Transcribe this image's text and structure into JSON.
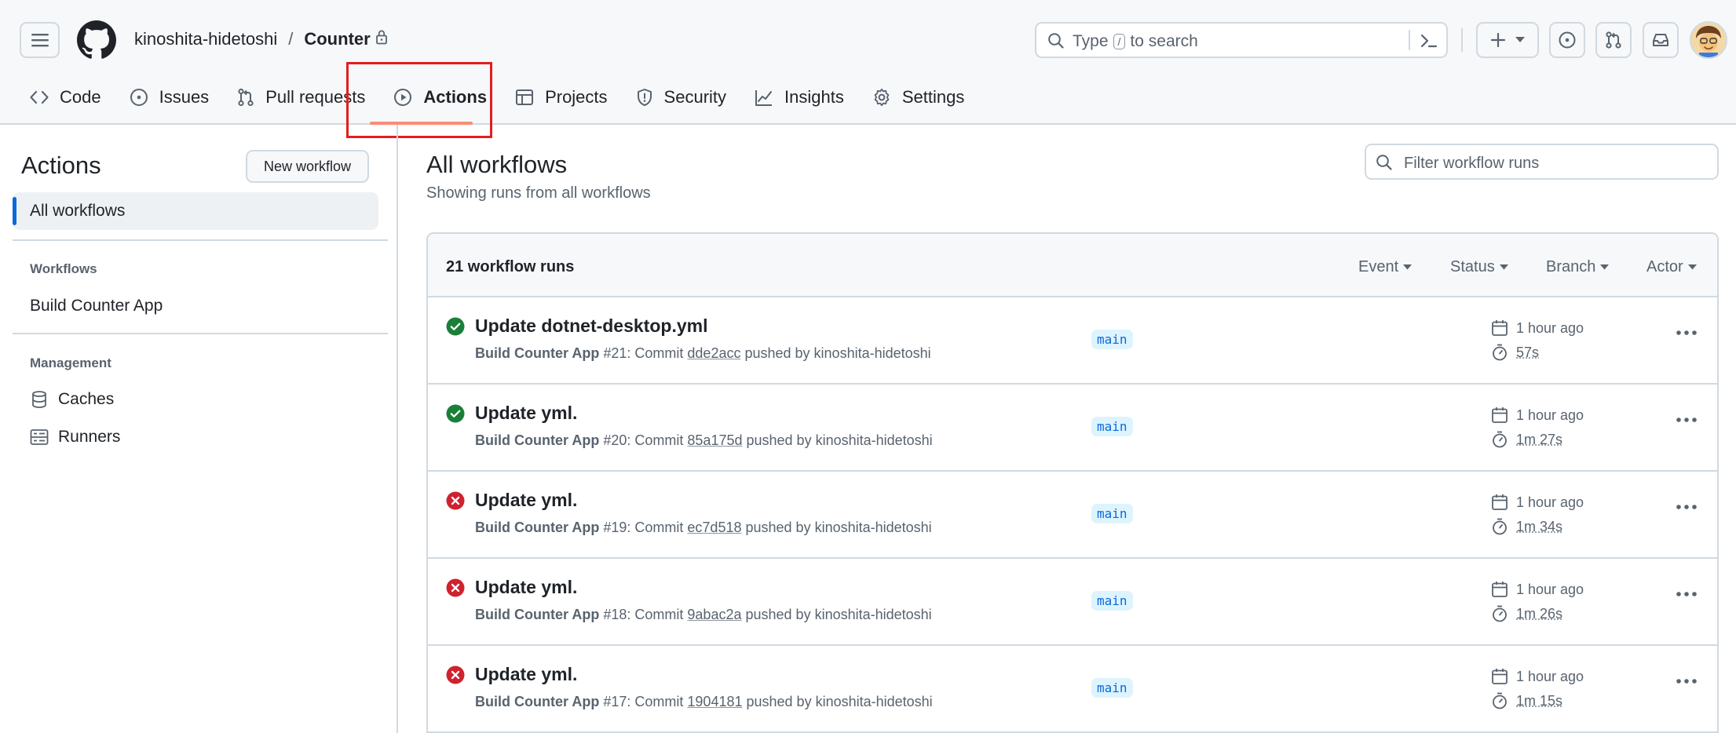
{
  "header": {
    "owner": "kinoshita-hidetoshi",
    "separator": "/",
    "repo": "Counter",
    "search_prefix": "Type",
    "search_key": "/",
    "search_suffix": "to search"
  },
  "nav": {
    "tabs": [
      {
        "label": "Code",
        "icon": "code-icon"
      },
      {
        "label": "Issues",
        "icon": "issue-icon"
      },
      {
        "label": "Pull requests",
        "icon": "pull-request-icon"
      },
      {
        "label": "Actions",
        "icon": "play-icon",
        "active": true
      },
      {
        "label": "Projects",
        "icon": "table-icon"
      },
      {
        "label": "Security",
        "icon": "shield-icon"
      },
      {
        "label": "Insights",
        "icon": "graph-icon"
      },
      {
        "label": "Settings",
        "icon": "gear-icon"
      }
    ]
  },
  "sidebar": {
    "title": "Actions",
    "new_workflow": "New workflow",
    "all_workflows": "All workflows",
    "workflows_heading": "Workflows",
    "workflows": [
      "Build Counter App"
    ],
    "management_heading": "Management",
    "management": [
      {
        "label": "Caches",
        "icon": "database-icon"
      },
      {
        "label": "Runners",
        "icon": "server-icon"
      }
    ]
  },
  "main": {
    "title": "All workflows",
    "subtitle": "Showing runs from all workflows",
    "filter_placeholder": "Filter workflow runs",
    "runs_count": "21 workflow runs",
    "filters": [
      "Event",
      "Status",
      "Branch",
      "Actor"
    ],
    "runs": [
      {
        "status": "success",
        "title": "Update dotnet-desktop.yml",
        "workflow": "Build Counter App",
        "number": "#21",
        "commit_label": "Commit",
        "sha": "dde2acc",
        "pushed_by": "pushed by kinoshita-hidetoshi",
        "branch": "main",
        "when": "1 hour ago",
        "duration": "57s"
      },
      {
        "status": "success",
        "title": "Update yml.",
        "workflow": "Build Counter App",
        "number": "#20",
        "commit_label": "Commit",
        "sha": "85a175d",
        "pushed_by": "pushed by kinoshita-hidetoshi",
        "branch": "main",
        "when": "1 hour ago",
        "duration": "1m 27s"
      },
      {
        "status": "failure",
        "title": "Update yml.",
        "workflow": "Build Counter App",
        "number": "#19",
        "commit_label": "Commit",
        "sha": "ec7d518",
        "pushed_by": "pushed by kinoshita-hidetoshi",
        "branch": "main",
        "when": "1 hour ago",
        "duration": "1m 34s"
      },
      {
        "status": "failure",
        "title": "Update yml.",
        "workflow": "Build Counter App",
        "number": "#18",
        "commit_label": "Commit",
        "sha": "9abac2a",
        "pushed_by": "pushed by kinoshita-hidetoshi",
        "branch": "main",
        "when": "1 hour ago",
        "duration": "1m 26s"
      },
      {
        "status": "failure",
        "title": "Update yml.",
        "workflow": "Build Counter App",
        "number": "#17",
        "commit_label": "Commit",
        "sha": "1904181",
        "pushed_by": "pushed by kinoshita-hidetoshi",
        "branch": "main",
        "when": "1 hour ago",
        "duration": "1m 15s"
      }
    ]
  },
  "colors": {
    "success": "#1a7f37",
    "failure": "#cf222e",
    "accent": "#0969da",
    "highlight": "#e21e1e"
  }
}
